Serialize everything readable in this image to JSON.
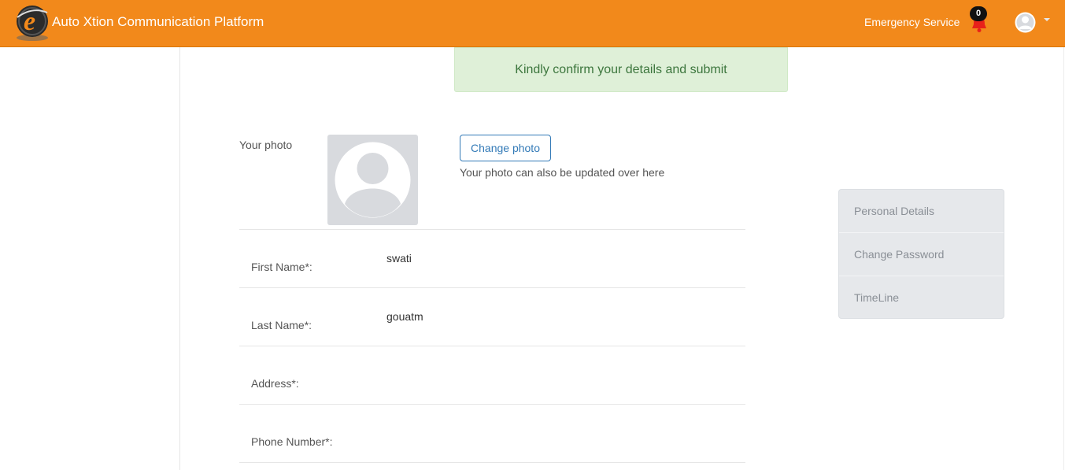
{
  "header": {
    "app_title": "Auto Xtion Communication Platform",
    "emergency_label": "Emergency Service",
    "notification_count": "0",
    "brand_color": "#f2891b"
  },
  "alert": {
    "message": "Kindly confirm your details and submit",
    "color": "#dff0d8"
  },
  "photo": {
    "label": "Your photo",
    "change_button": "Change photo",
    "help_text": "Your photo can also be updated over here"
  },
  "form": {
    "rows": [
      {
        "label": "First Name*:",
        "value": "swati"
      },
      {
        "label": "Last Name*:",
        "value": "gouatm"
      },
      {
        "label": "Address*:",
        "value": ""
      },
      {
        "label": "Phone Number*:",
        "value": ""
      }
    ]
  },
  "side_nav": {
    "items": [
      {
        "label": "Personal Details"
      },
      {
        "label": "Change Password"
      },
      {
        "label": "TimeLine"
      }
    ]
  },
  "icons": {
    "logo": "e-globe-logo",
    "bell": "bell-icon",
    "avatar": "user-avatar-icon",
    "caret": "chevron-down-icon",
    "photo_placeholder": "user-placeholder-icon"
  }
}
